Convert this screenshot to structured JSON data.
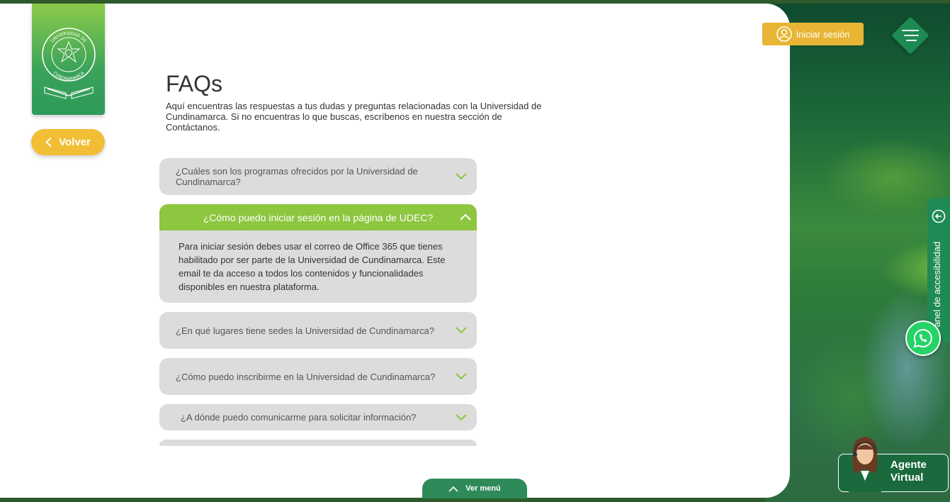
{
  "header": {
    "login_label": "Iniciar sesión"
  },
  "logo": {
    "top_text": "UNIVERSIDAD DE CUNDINAMARCA",
    "ribbon_left": "EL UMBRA",
    "ribbon_right": "IN SCIENTIA"
  },
  "nav": {
    "back_label": "Volver"
  },
  "page": {
    "title": "FAQs",
    "intro": "Aquí encuentras las respuestas a tus dudas y preguntas relacionadas con la Universidad de Cundinamarca. Si no encuentras lo que buscas, escríbenos en nuestra sección de Contáctanos."
  },
  "faqs": [
    {
      "question": "¿Cuáles son los programas ofrecidos por la Universidad de Cundinamarca?",
      "expanded": false
    },
    {
      "question": "¿Cómo puedo iniciar sesión en la página de UDEC?",
      "expanded": true,
      "answer": "Para iniciar sesión debes usar el correo de Office 365 que tienes habilitado por ser parte de la Universidad de Cundinamarca. Este email te da acceso a todos los contenidos y funcionalidades disponibles en nuestra plataforma."
    },
    {
      "question": "¿En qué lugares tiene sedes la Universidad de Cundinamarca?",
      "expanded": false
    },
    {
      "question": "¿Cómo puedo inscribirme en la Universidad de Cundinamarca?",
      "expanded": false
    },
    {
      "question": "¿A dónde puedo comunicarme para solicitar información?",
      "expanded": false
    }
  ],
  "side": {
    "accessibility_label": "Panel de accesibilidad",
    "agent_label": "Agente Virtual"
  },
  "footer": {
    "ver_menu_label": "Ver menú"
  },
  "colors": {
    "accent_green": "#8dc63f",
    "dark_green": "#1f8a54",
    "yellow": "#f2be36"
  }
}
